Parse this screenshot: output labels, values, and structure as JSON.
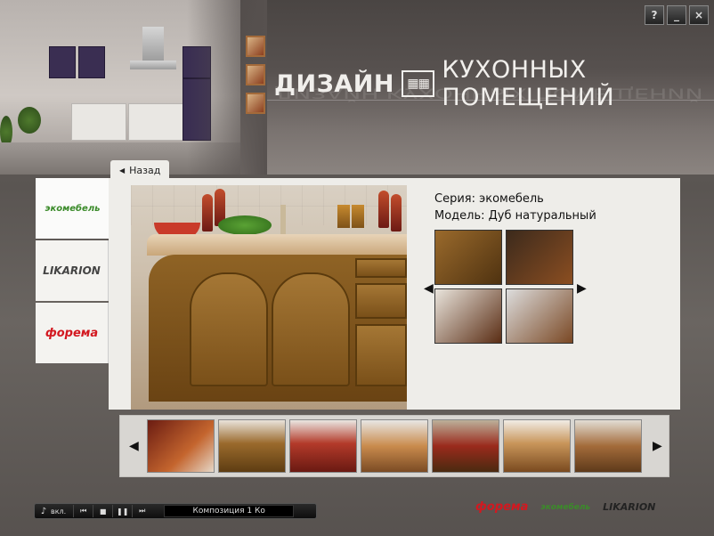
{
  "window": {
    "controls": [
      "?",
      "_",
      "×"
    ]
  },
  "header": {
    "title_bold": "ДИЗАЙН",
    "title_logo": "▦▦",
    "title_rest": "КУХОННЫХ ПОМЕЩЕНИЙ"
  },
  "nav": {
    "back_label": "Назад"
  },
  "brands": [
    {
      "name": "экомебель"
    },
    {
      "name": "LIKARION"
    },
    {
      "name": "форема"
    }
  ],
  "product": {
    "series": "Серия: экомебель",
    "model": "Модель: Дуб натуральный"
  },
  "player": {
    "toggle_label": "вкл.",
    "track": "Композиция 1    Ко"
  },
  "footer": {
    "logos": [
      "форема",
      "экомебель",
      "LIKARION"
    ]
  }
}
